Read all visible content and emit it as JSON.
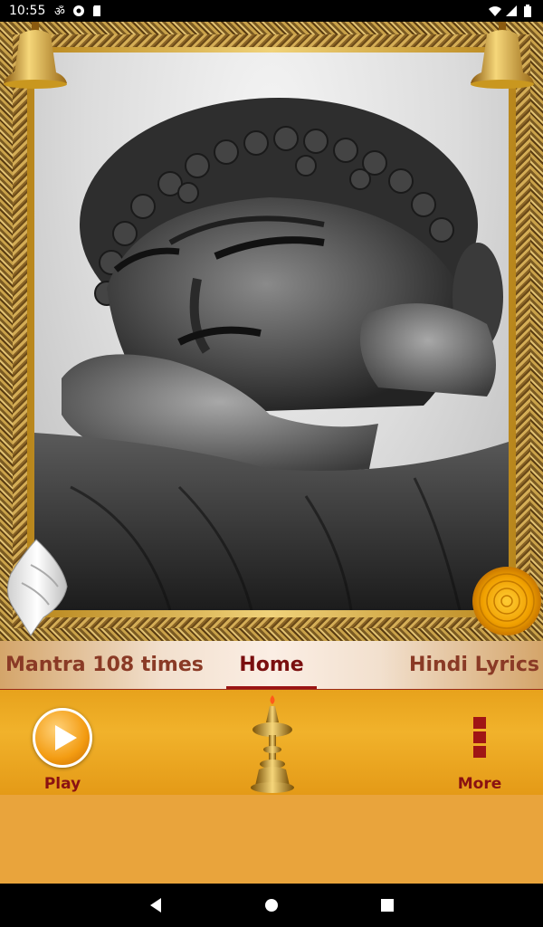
{
  "status_bar": {
    "time": "10:55",
    "left_icons": [
      "om-icon",
      "audio-app-icon",
      "sd-card-icon"
    ],
    "right_icons": [
      "wifi-icon",
      "cell-signal-icon",
      "battery-icon"
    ]
  },
  "hero": {
    "image": "buddha-statue-photo",
    "decorations": [
      "bell-icon",
      "bell-icon",
      "conch-shell-icon",
      "marigold-flower-icon"
    ]
  },
  "tabs": [
    {
      "label": "Mantra 108 times",
      "active": false
    },
    {
      "label": "Home",
      "active": true
    },
    {
      "label": "Hindi Lyrics",
      "active": false
    }
  ],
  "toolbar": {
    "play_label": "Play",
    "center_icon": "oil-lamp-icon",
    "more_label": "More"
  },
  "colors": {
    "tab_active": "#7a0f0f",
    "tab_inactive": "#8a3a26",
    "toolbar_bg": "#f1b22b",
    "lower_area_bg": "#e9a43c",
    "label_color": "#8a1212"
  },
  "nav_bar": {
    "buttons": [
      "back-icon",
      "home-icon",
      "recents-icon"
    ]
  }
}
